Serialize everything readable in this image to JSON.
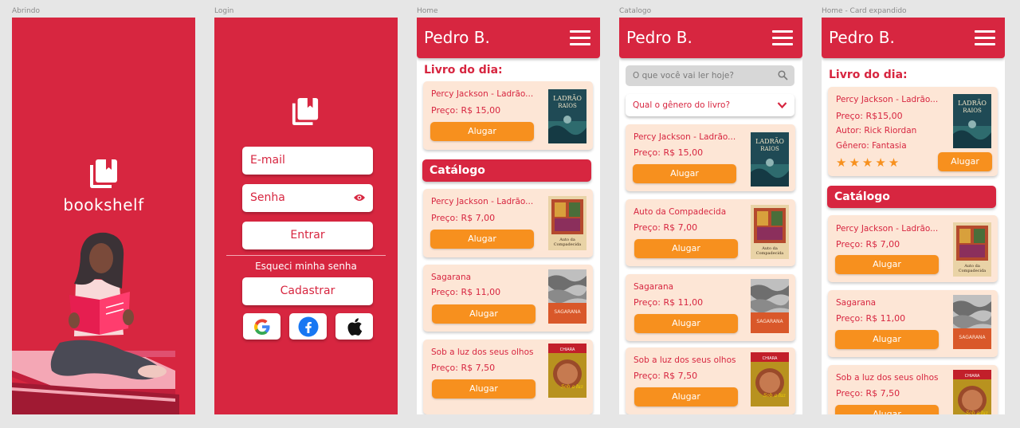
{
  "frames": {
    "splash": "Abrindo",
    "login": "Login",
    "home": "Home",
    "catalog": "Catalogo",
    "expanded": "Home - Card expandido"
  },
  "colors": {
    "brand_red": "#d72640",
    "accent_orange": "#f7901e",
    "card_bg": "#fde6d6"
  },
  "splash": {
    "app_name": "bookshelf"
  },
  "login": {
    "email_placeholder": "E-mail",
    "password_placeholder": "Senha",
    "login_button": "Entrar",
    "forgot_password": "Esqueci minha senha",
    "register_button": "Cadastrar",
    "social": [
      "google-icon",
      "facebook-icon",
      "apple-icon"
    ]
  },
  "user": {
    "name": "Pedro B."
  },
  "home": {
    "book_of_day_title": "Livro do dia:",
    "catalog_title": "Catálogo",
    "featured": {
      "title": "Percy  Jackson - Ladrão...",
      "price": "Preço: R$ 15,00",
      "button": "Alugar"
    },
    "catalog": [
      {
        "title": "Percy  Jackson - Ladrão...",
        "price": "Preço: R$ 7,00",
        "button": "Alugar"
      },
      {
        "title": "Sagarana",
        "price": "Preço: R$ 11,00",
        "button": "Alugar"
      },
      {
        "title": "Sob a luz  dos seus olhos",
        "price": "Preço: R$ 7,50",
        "button": "Alugar"
      }
    ]
  },
  "catalog": {
    "search_placeholder": "O que você vai ler hoje?",
    "genre_dropdown": "Qual o gênero do livro?",
    "items": [
      {
        "title": "Percy  Jackson - Ladrão...",
        "price": "Preço: R$ 15,00",
        "button": "Alugar"
      },
      {
        "title": "Auto da Compadecida",
        "price": "Preço: R$ 7,00",
        "button": "Alugar"
      },
      {
        "title": "Sagarana",
        "price": "Preço: R$ 11,00",
        "button": "Alugar"
      },
      {
        "title": "Sob a luz  dos seus olhos",
        "price": "Preço: R$ 7,50",
        "button": "Alugar"
      }
    ]
  },
  "expanded": {
    "book_of_day_title": "Livro do dia:",
    "catalog_title": "Catálogo",
    "featured": {
      "title": "Percy  Jackson - Ladrão...",
      "price": "Preço: R$15,00",
      "author": "Autor: Rick Riordan",
      "genre": "Gênero: Fantasia",
      "rating": 5,
      "stars": "★★★★★",
      "button": "Alugar"
    },
    "catalog": [
      {
        "title": "Percy  Jackson - Ladrão...",
        "price": "Preço: R$ 7,00",
        "button": "Alugar"
      },
      {
        "title": "Sagarana",
        "price": "Preço: R$ 11,00",
        "button": "Alugar"
      },
      {
        "title": "Sob a luz  dos seus olhos",
        "price": "Preço: R$ 7,50",
        "button": "Alugar"
      }
    ]
  }
}
